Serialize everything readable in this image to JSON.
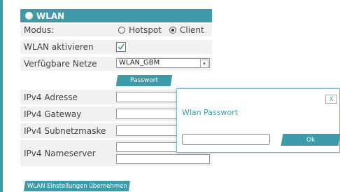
{
  "header": {
    "title": "WLAN"
  },
  "rows": {
    "modus": {
      "label": "Modus:",
      "options": [
        "Hotspot",
        "Client"
      ],
      "selected": "Client"
    },
    "wlan_aktivieren": {
      "label": "WLAN aktivieren",
      "checked": true
    },
    "netze": {
      "label": "Verfügbare Netze",
      "value": "WLAN_GBM"
    },
    "ipv4_adresse": {
      "label": "IPv4 Adresse"
    },
    "ipv4_gateway": {
      "label": "IPv4 Gateway"
    },
    "ipv4_subnetz": {
      "label": "IPv4 Subnetzmaske"
    },
    "ipv4_nameserver": {
      "label": "IPv4 Nameserver"
    }
  },
  "buttons": {
    "passwort": "Passwort",
    "apply": "WLAN Einstellungen übernehmen"
  },
  "dialog": {
    "title": "Wlan Passwort",
    "close": "X",
    "ok": "Ok",
    "password_value": ""
  },
  "colors": {
    "accent": "#3d9aa8",
    "row_bg": "#f1f1f1"
  }
}
